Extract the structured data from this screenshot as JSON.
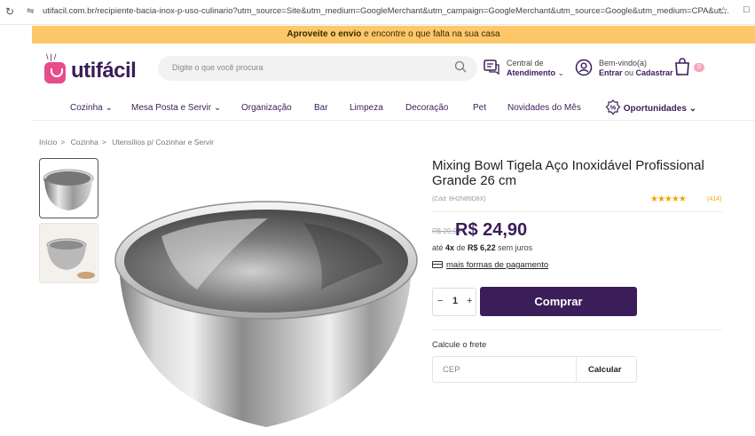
{
  "browser": {
    "url": "utifacil.com.br/recipiente-bacia-inox-p-uso-culinario?utm_source=Site&utm_medium=GoogleMerchant&utm_campaign=GoogleMerchant&utm_source=Google&utm_medium=CPA&utm_cam..."
  },
  "promo": {
    "bold": "Aproveite o envio",
    "rest": " e encontre o que falta na sua casa"
  },
  "header": {
    "logo_text": "utifácil",
    "search_placeholder": "Digite o que você procura",
    "support_line1": "Central de",
    "support_line2": "Atendimento",
    "account_line1": "Bem-vindo(a)",
    "account_enter": "Entrar",
    "account_or": " ou ",
    "account_register": "Cadastrar",
    "cart_count": "0"
  },
  "nav": {
    "items": [
      "Cozinha",
      "Mesa Posta e Servir",
      "Organização",
      "Bar",
      "Limpeza",
      "Decoração",
      "Pet",
      "Novidades do Mês",
      "Oportunidades"
    ]
  },
  "breadcrumb": {
    "items": [
      "Início",
      "Cozinha",
      "Utensílios p/ Cozinhar e Servir"
    ],
    "separator": ">"
  },
  "product": {
    "title": "Mixing Bowl Tigela Aço Inoxidável Profissional Grande 26 cm",
    "code": "(Cód: 8H2N89D8X)",
    "rating_stars": "★★★★★",
    "rating_count": "(414)",
    "old_price": "R$ 29,90",
    "price": "R$ 24,90",
    "install_prefix": "até ",
    "install_times": "4x",
    "install_mid": " de ",
    "install_value": "R$ 6,22",
    "install_suffix": " sem juros",
    "payment_link": "mais formas de pagamento",
    "qty_minus": "−",
    "qty_value": "1",
    "qty_plus": "+",
    "buy_label": "Comprar",
    "shipping_label": "Calcule o frete",
    "cep_placeholder": "CEP",
    "calc_label": "Calcular"
  },
  "colors": {
    "brand": "#3a1d59",
    "promo_bg": "#fdc86a",
    "logo_pink": "#e84c8a",
    "star": "#f0a500"
  }
}
